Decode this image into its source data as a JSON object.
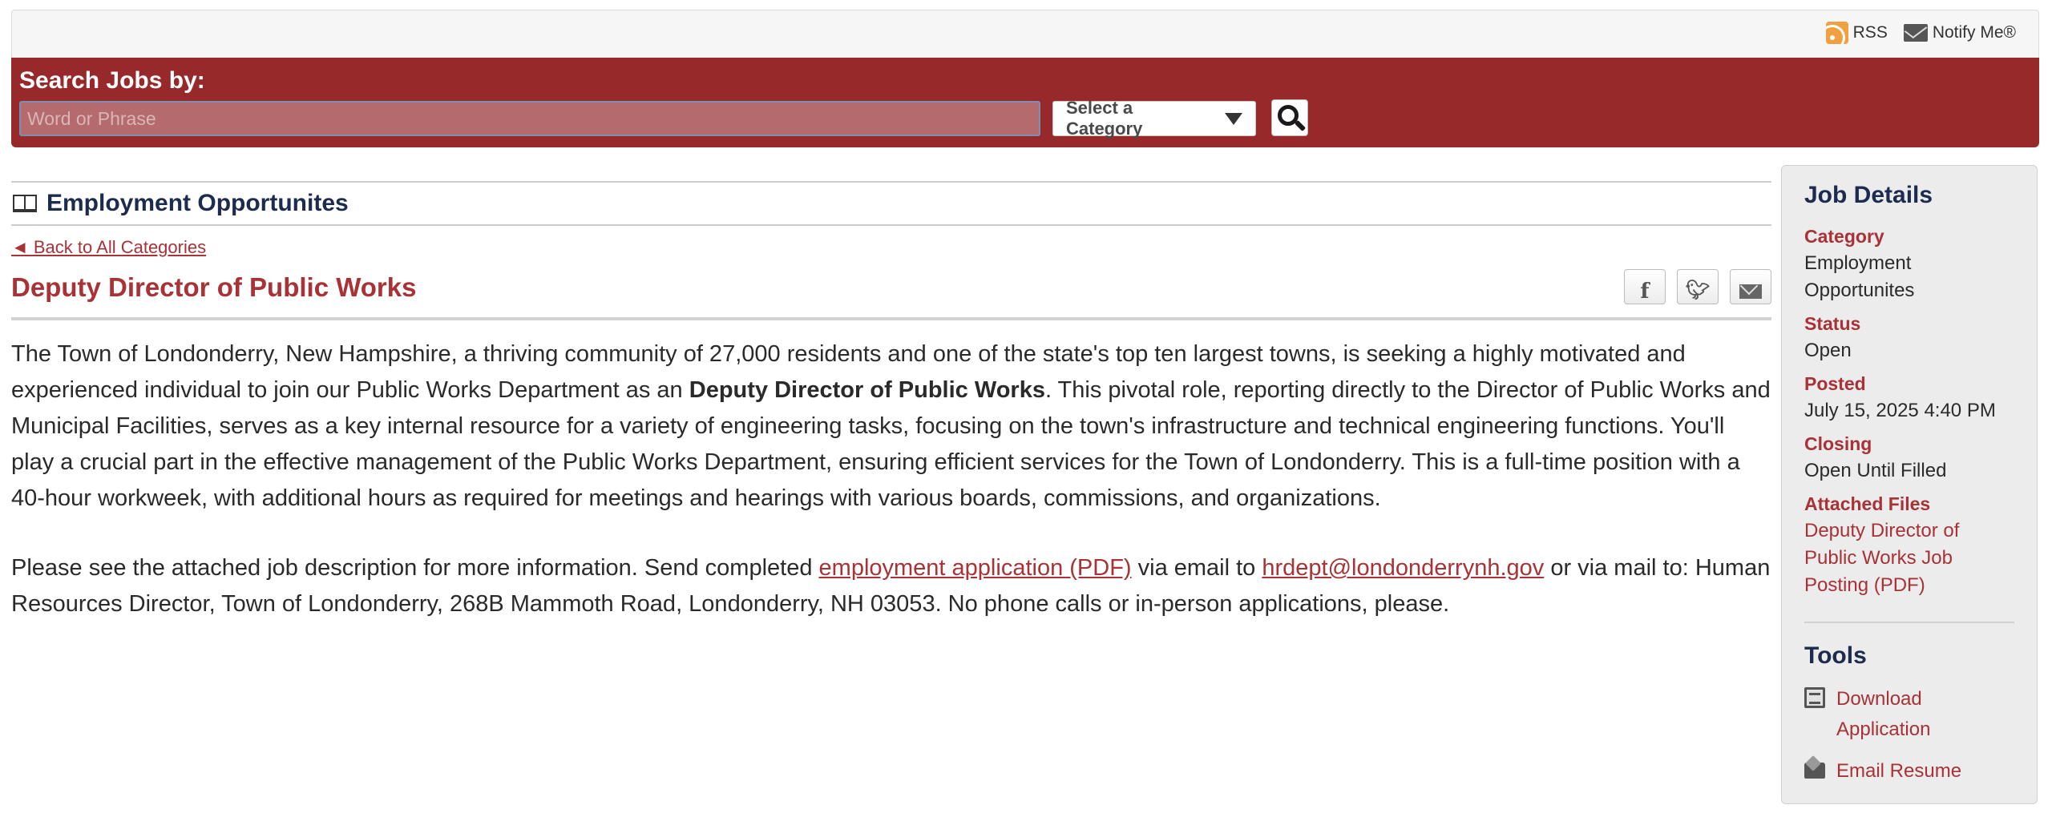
{
  "topbar": {
    "rss_label": "RSS",
    "notify_label": "Notify Me®"
  },
  "search": {
    "heading": "Search Jobs by:",
    "placeholder": "Word or Phrase",
    "category_label": "Select a Category"
  },
  "module": {
    "title": "Employment Opportunites",
    "back_link": "◄ Back to All Categories"
  },
  "job": {
    "title": "Deputy Director of Public Works",
    "p1_part1": "The Town of Londonderry, New Hampshire, a thriving community of 27,000 residents and one of the state's top ten largest towns, is seeking a highly motivated and experienced individual to join our Public Works Department as an ",
    "p1_bold": "Deputy Director of Public Works",
    "p1_part2": ". This pivotal role, reporting directly to the Director of Public Works and Municipal Facilities, serves as a key internal resource for a variety of engineering tasks, focusing on the town's infrastructure and technical engineering functions. You'll play a crucial part in the effective management of the Public Works Department, ensuring efficient services for the Town of Londonderry. This is a full-time position with a 40-hour workweek, with additional hours as required for meetings and hearings with various boards, commissions, and organizations.",
    "p2_part1": "Please see the attached job description for more information. Send completed ",
    "p2_link1": "employment application (PDF)",
    "p2_part2": " via email to ",
    "p2_link2": "hrdept@londonderrynh.gov",
    "p2_part3": " or via mail to: Human Resources Director, Town of Londonderry, 268B Mammoth Road, Londonderry, NH 03053. No phone calls or in-person applications, please."
  },
  "sidebar": {
    "details_heading": "Job Details",
    "category_label": "Category",
    "category_value": "Employment Opportunites",
    "status_label": "Status",
    "status_value": "Open",
    "posted_label": "Posted",
    "posted_value": "July 15, 2025 4:40 PM",
    "closing_label": "Closing",
    "closing_value": "Open Until Filled",
    "files_label": "Attached Files",
    "file_link": "Deputy Director of Public Works Job Posting (PDF)",
    "tools_heading": "Tools",
    "tool_download": "Download Application",
    "tool_email": "Email Resume"
  },
  "colors": {
    "header_red": "#97292b",
    "link_red": "#a83236",
    "heading_navy": "#1d2b4f"
  }
}
